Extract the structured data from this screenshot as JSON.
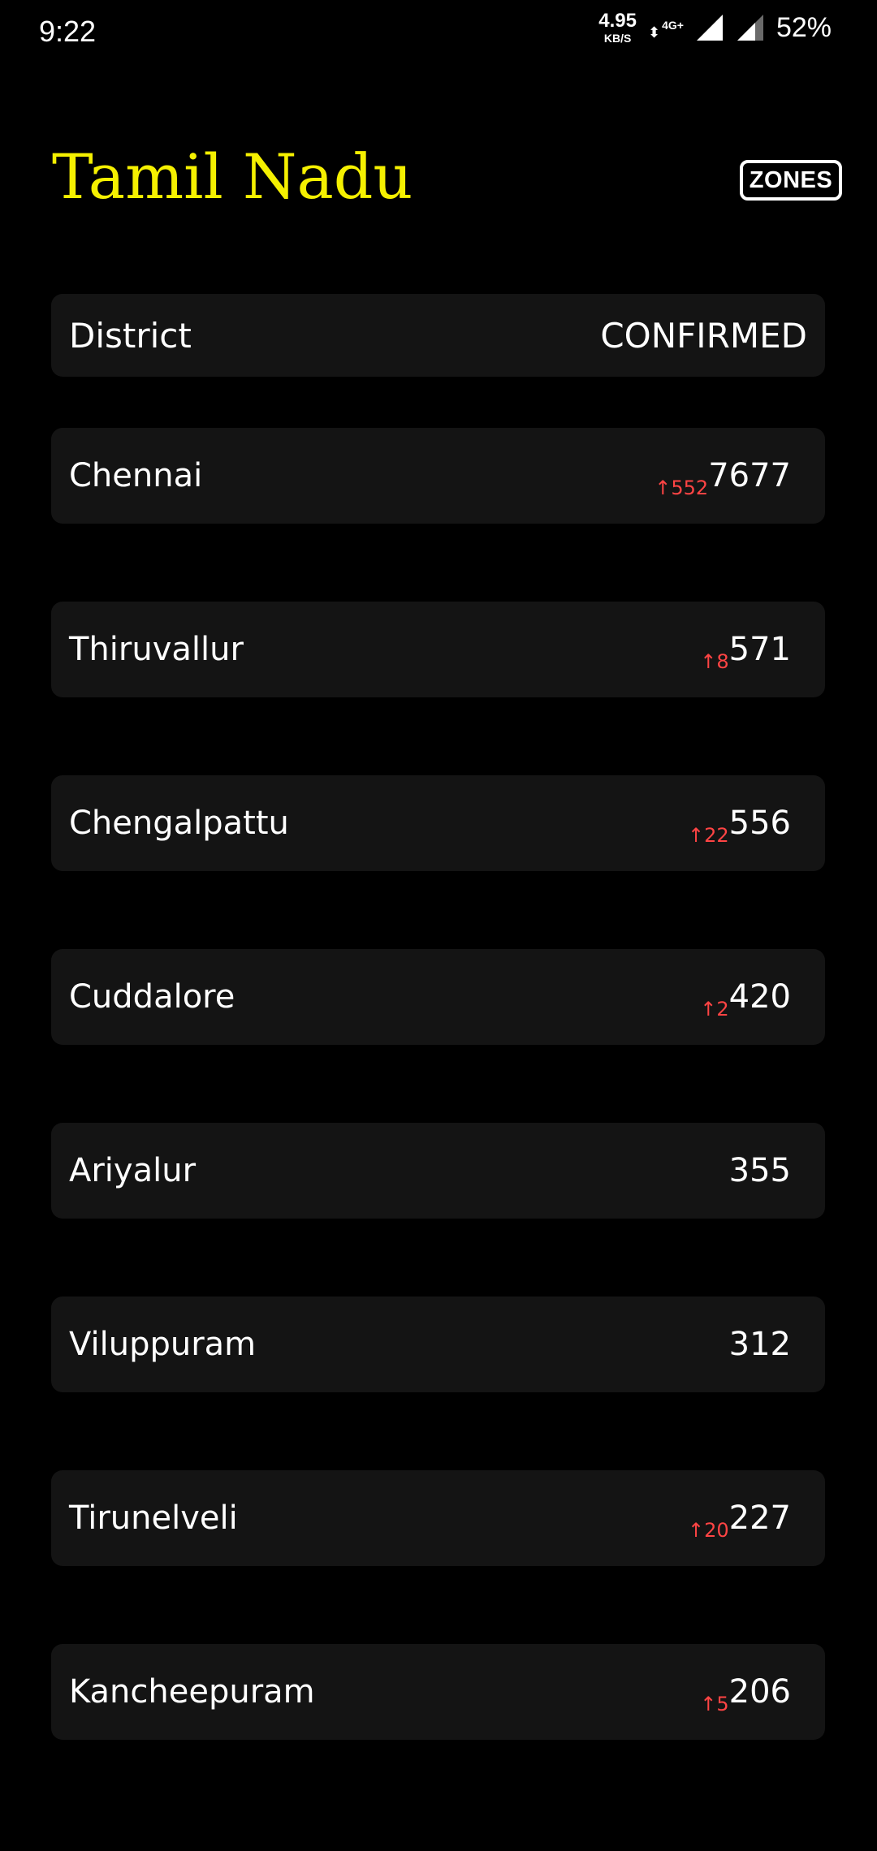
{
  "status_bar": {
    "time": "9:22",
    "net_speed": "4.95",
    "net_speed_unit": "KB/S",
    "net_type": "4G+",
    "net_arrows": "⬍",
    "battery": "52%"
  },
  "header": {
    "title": "Tamil Nadu",
    "zones_label": "ZONES"
  },
  "table": {
    "district_header": "District",
    "confirmed_header": "CONFIRMED",
    "rows": [
      {
        "district": "Chennai",
        "delta": "↑552",
        "confirmed": "7677"
      },
      {
        "district": "Thiruvallur",
        "delta": "↑8",
        "confirmed": "571"
      },
      {
        "district": "Chengalpattu",
        "delta": "↑22",
        "confirmed": "556"
      },
      {
        "district": "Cuddalore",
        "delta": "↑2",
        "confirmed": "420"
      },
      {
        "district": "Ariyalur",
        "delta": "",
        "confirmed": "355"
      },
      {
        "district": "Viluppuram",
        "delta": "",
        "confirmed": "312"
      },
      {
        "district": "Tirunelveli",
        "delta": "↑20",
        "confirmed": "227"
      },
      {
        "district": "Kancheepuram",
        "delta": "↑5",
        "confirmed": "206"
      }
    ]
  },
  "colors": {
    "background": "#000000",
    "title": "#f5f000",
    "row_background": "#141414",
    "delta": "#ff4444",
    "text": "#ffffff"
  }
}
